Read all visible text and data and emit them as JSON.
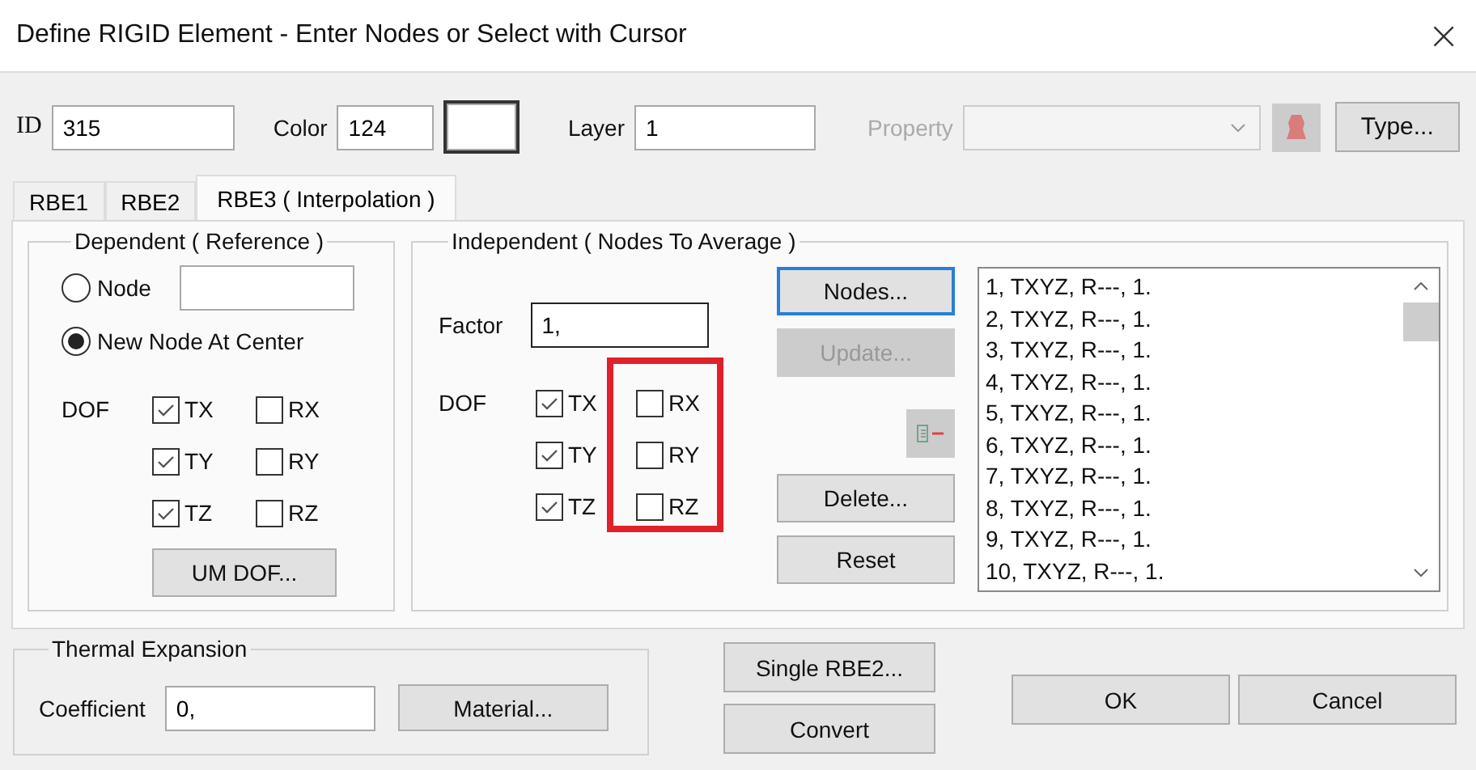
{
  "window": {
    "title": "Define RIGID Element - Enter Nodes or Select with Cursor",
    "close": "×"
  },
  "toolbar": {
    "id": {
      "label": "ID",
      "value": "315"
    },
    "color": {
      "label": "Color",
      "value": "124"
    },
    "layer": {
      "label": "Layer",
      "value": "1"
    },
    "property": {
      "label": "Property",
      "disabled": true
    },
    "type_button": "Type..."
  },
  "tabs": [
    {
      "label": "RBE1",
      "selected": false
    },
    {
      "label": "RBE2",
      "selected": false
    },
    {
      "label": "RBE3 ( Interpolation )",
      "selected": true
    }
  ],
  "dependent": {
    "title": "Dependent ( Reference )",
    "options": [
      {
        "label": "Node",
        "selected": false,
        "kind": "field"
      },
      {
        "label": "New Node At Center",
        "selected": true,
        "kind": "plain"
      }
    ],
    "dof_label": "DOF",
    "dof": [
      {
        "label": "TX",
        "checked": true
      },
      {
        "label": "RX",
        "checked": false
      },
      {
        "label": "TY",
        "checked": true
      },
      {
        "label": "RY",
        "checked": false
      },
      {
        "label": "TZ",
        "checked": true
      },
      {
        "label": "RZ",
        "checked": false
      }
    ],
    "um_button": "UM DOF..."
  },
  "independent": {
    "title": "Independent ( Nodes To Average )",
    "factor": {
      "label": "Factor",
      "value": "1,"
    },
    "dof_label": "DOF",
    "dof": [
      {
        "label": "TX",
        "checked": true
      },
      {
        "label": "RX",
        "checked": false
      },
      {
        "label": "TY",
        "checked": true
      },
      {
        "label": "RY",
        "checked": false
      },
      {
        "label": "TZ",
        "checked": true
      },
      {
        "label": "RZ",
        "checked": false
      }
    ],
    "buttons": [
      {
        "kind": "text",
        "label": "Nodes...",
        "focused": true,
        "disabled": false
      },
      {
        "kind": "text",
        "label": "Update...",
        "focused": false,
        "disabled": true
      },
      {
        "kind": "icon"
      },
      {
        "kind": "text",
        "label": "Delete...",
        "focused": false,
        "disabled": false
      },
      {
        "kind": "text",
        "label": "Reset",
        "focused": false,
        "disabled": false
      }
    ],
    "nodes_list": [
      "1, TXYZ, R---, 1.",
      "2, TXYZ, R---, 1.",
      "3, TXYZ, R---, 1.",
      "4, TXYZ, R---, 1.",
      "5, TXYZ, R---, 1.",
      "6, TXYZ, R---, 1.",
      "7, TXYZ, R---, 1.",
      "8, TXYZ, R---, 1.",
      "9, TXYZ, R---, 1.",
      "10, TXYZ, R---, 1."
    ]
  },
  "thermal": {
    "title": "Thermal Expansion",
    "coefficient": {
      "label": "Coefficient",
      "value": "0,"
    },
    "material_button": "Material..."
  },
  "actions": [
    "Single RBE2...",
    "Convert"
  ],
  "dialog_buttons": [
    "OK",
    "Cancel"
  ]
}
